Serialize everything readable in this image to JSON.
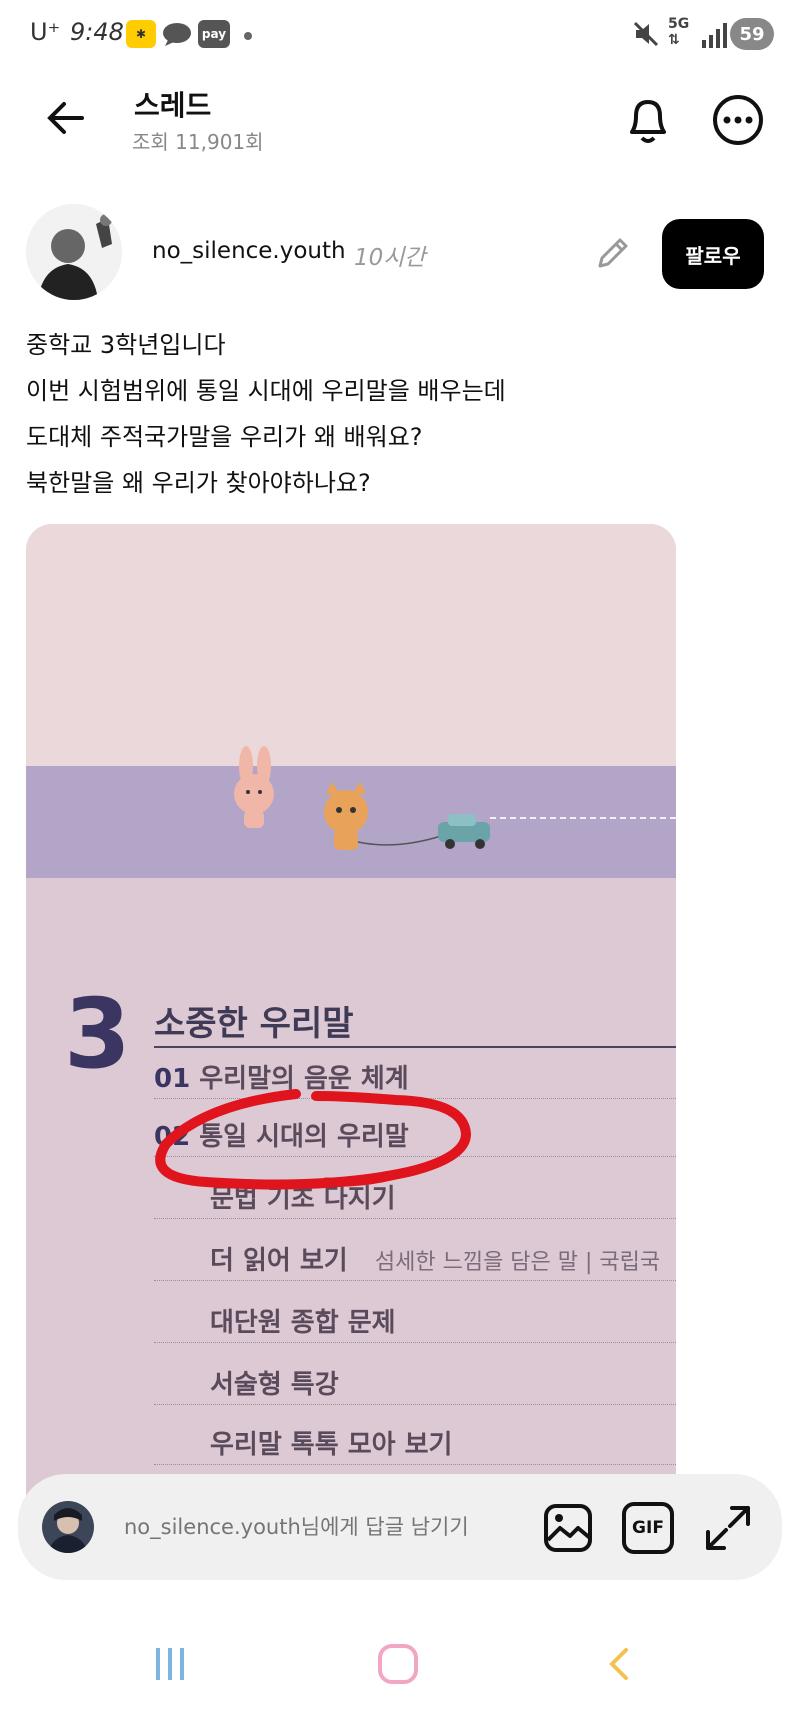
{
  "status_bar": {
    "carrier": "U⁺",
    "time": "9:48",
    "app_pay_label": "pay",
    "network": "5G",
    "battery": "59"
  },
  "header": {
    "title": "스레드",
    "views": "조회 11,901회"
  },
  "post": {
    "author": "no_silence.youth",
    "time_ago": "10시간",
    "follow_label": "팔로우",
    "lines": [
      "중학교 3학년입니다",
      "이번 시험범위에 통일 시대에 우리말을 배우는데",
      "도대체 주적국가말을 우리가 왜 배워요?",
      "북한말을 왜 우리가 찾아야하나요?"
    ]
  },
  "photo": {
    "chapter_number": "3",
    "chapter_title": "소중한 우리말",
    "items": [
      {
        "num": "01",
        "label": "우리말의 음운 체계"
      },
      {
        "num": "02",
        "label": "통일 시대의 우리말"
      },
      {
        "num": "",
        "label": "문법 기초 다지기"
      },
      {
        "num": "",
        "label": "더 읽어 보기",
        "extra": "섬세한 느낌을 담은 말 | 국립국"
      },
      {
        "num": "",
        "label": "대단원 종합 문제"
      },
      {
        "num": "",
        "label": "서술형 특강"
      },
      {
        "num": "",
        "label": "우리말 톡톡 모아 보기"
      }
    ]
  },
  "reply_bar": {
    "placeholder": "no_silence.youth님에게 답글 남기기",
    "gif_label": "GIF"
  },
  "colors": {
    "follow_bg": "#000000",
    "reply_bg": "#f0f0f0",
    "nav_recent": "#7fb4e0",
    "nav_home": "#f2a6c4",
    "nav_back": "#f2c14e",
    "highlight_circle": "#e0141c"
  }
}
